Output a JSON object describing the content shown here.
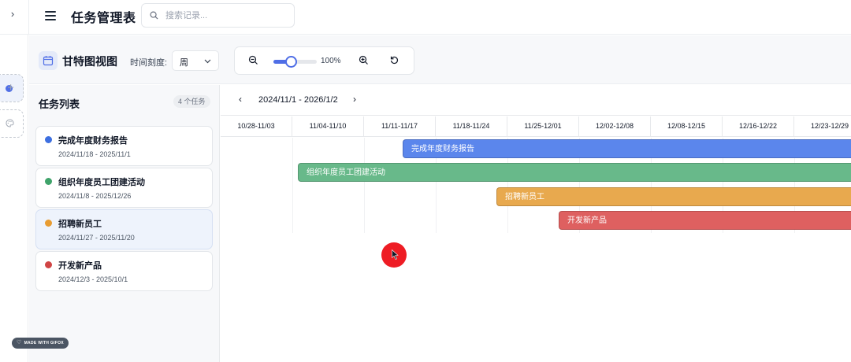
{
  "header": {
    "title": "任务管理表",
    "expand_icon": "›",
    "search_placeholder": "搜索记录..."
  },
  "rail": {
    "add_icon": "+",
    "palette_icon": "palette-icon"
  },
  "toolbar": {
    "view_title": "甘特图视图",
    "scale_label": "时间刻度:",
    "scale_value": "周",
    "zoom_percent": "100%",
    "zoom_level": 0.4
  },
  "task_list": {
    "title": "任务列表",
    "count": "4 个任务",
    "tasks": [
      {
        "name": "完成年度财务报告",
        "dates": "2024/11/18 - 2025/11/1",
        "color": "#3d6fe0",
        "selected": false
      },
      {
        "name": "组织年度员工团建活动",
        "dates": "2024/11/8 - 2025/12/26",
        "color": "#3fa36a",
        "selected": false
      },
      {
        "name": "招聘新员工",
        "dates": "2024/11/27 - 2025/11/20",
        "color": "#e89c32",
        "selected": true
      },
      {
        "name": "开发新产品",
        "dates": "2024/12/3 - 2025/10/1",
        "color": "#d04545",
        "selected": false
      }
    ]
  },
  "gantt": {
    "range": "2024/11/1 - 2026/1/2",
    "prev_icon": "‹",
    "next_icon": "›",
    "weeks": [
      "10/28-11/03",
      "11/04-11/10",
      "11/11-11/17",
      "11/18-11/24",
      "11/25-12/01",
      "12/02-12/08",
      "12/08-12/15",
      "12/16-12/22",
      "12/23-12/29"
    ],
    "bars": [
      {
        "label": "完成年度财务报告",
        "color": "#5b86ec"
      },
      {
        "label": "组织年度员工团建活动",
        "color": "#68b98a"
      },
      {
        "label": "招聘新员工",
        "color": "#e8a94e"
      },
      {
        "label": "开发新产品",
        "color": "#de6060"
      }
    ]
  },
  "watermark": "MADE WITH GIFOX"
}
